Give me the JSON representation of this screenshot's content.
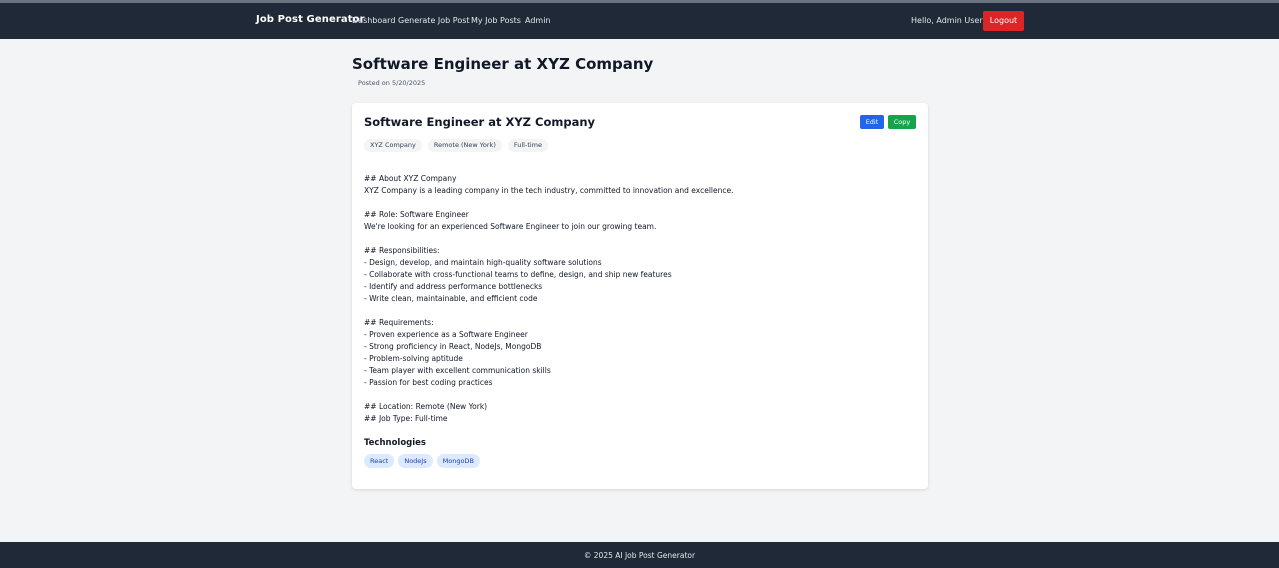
{
  "nav": {
    "brand": "Job Post Generator",
    "links": [
      "Dashboard",
      "Generate Job Post",
      "My Job Posts",
      "Admin"
    ],
    "greeting": "Hello, Admin User",
    "logout_label": "Logout",
    "logout_color": "#dc2626",
    "background_color": "#1f2937"
  },
  "page": {
    "title": "Software Engineer at XYZ Company",
    "posted": "Posted on 5/20/2025"
  },
  "card": {
    "title": "Software Engineer at XYZ Company",
    "edit_label": "Edit",
    "copy_label": "Copy",
    "tags": [
      "XYZ Company",
      "Remote (New York)",
      "Full-time"
    ],
    "description_lines": [
      "## About XYZ Company",
      "XYZ Company is a leading company in the tech industry, committed to innovation and excellence.",
      "",
      "## Role: Software Engineer",
      "We're looking for an experienced Software Engineer to join our growing team.",
      "",
      "## Responsibilities:",
      "- Design, develop, and maintain high-quality software solutions",
      "- Collaborate with cross-functional teams to define, design, and ship new features",
      "- Identify and address performance bottlenecks",
      "- Write clean, maintainable, and efficient code",
      "",
      "## Requirements:",
      "- Proven experience as a Software Engineer",
      "- Strong proficiency in React, NodeJs, MongoDB",
      "- Problem-solving aptitude",
      "- Team player with excellent communication skills",
      "- Passion for best coding practices",
      "",
      "## Location: Remote (New York)",
      "## Job Type: Full-time"
    ],
    "technologies_heading": "Technologies",
    "technologies": [
      "React",
      "NodeJs",
      "MongoDB"
    ],
    "edit_color": "#2563eb",
    "copy_color": "#16a34a"
  },
  "footer": {
    "text": "© 2025 AI Job Post Generator"
  }
}
